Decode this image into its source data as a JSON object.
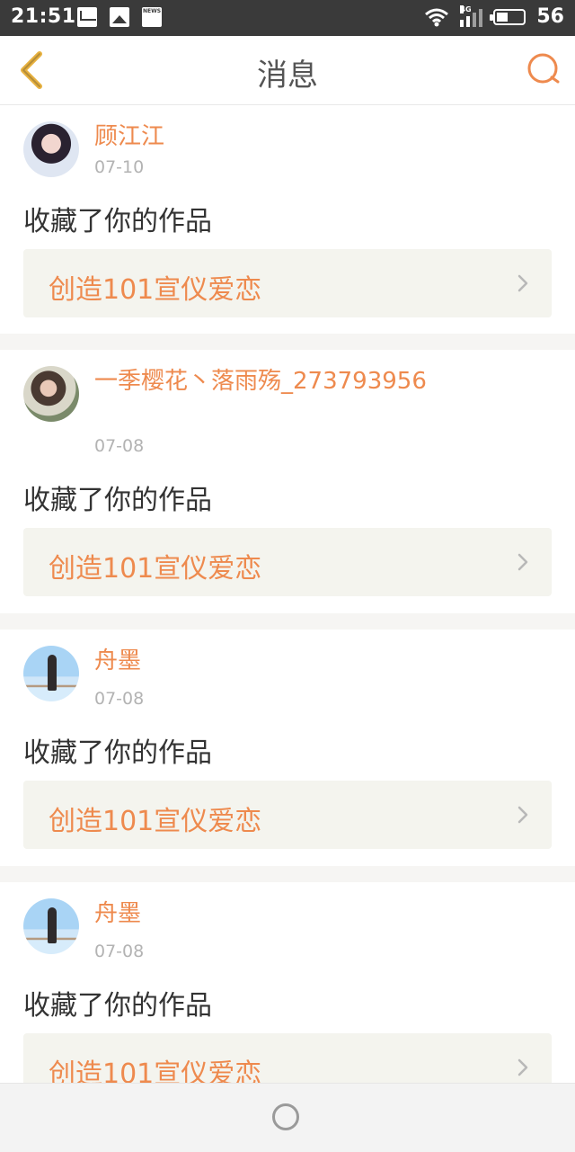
{
  "status_bar": {
    "time": "21:51",
    "battery": "56",
    "network_label": "4G"
  },
  "header": {
    "title": "消息",
    "back_icon": "chevron-left-icon",
    "search_icon": "search-icon"
  },
  "messages": [
    {
      "user": "顾江江",
      "date": "07-10",
      "action": "收藏了你的作品",
      "work": "创造101宣仪爱恋"
    },
    {
      "user": "一季樱花丶落雨殇_273793956",
      "date": "07-08",
      "action": "收藏了你的作品",
      "work": "创造101宣仪爱恋"
    },
    {
      "user": "舟墨",
      "date": "07-08",
      "action": "收藏了你的作品",
      "work": "创造101宣仪爱恋"
    },
    {
      "user": "舟墨",
      "date": "07-08",
      "action": "收藏了你的作品",
      "work": "创造101宣仪爱恋"
    }
  ],
  "colors": {
    "accent": "#ee8a4e",
    "back_icon": "#e7b13f",
    "row_bg": "#f4f4ee"
  }
}
